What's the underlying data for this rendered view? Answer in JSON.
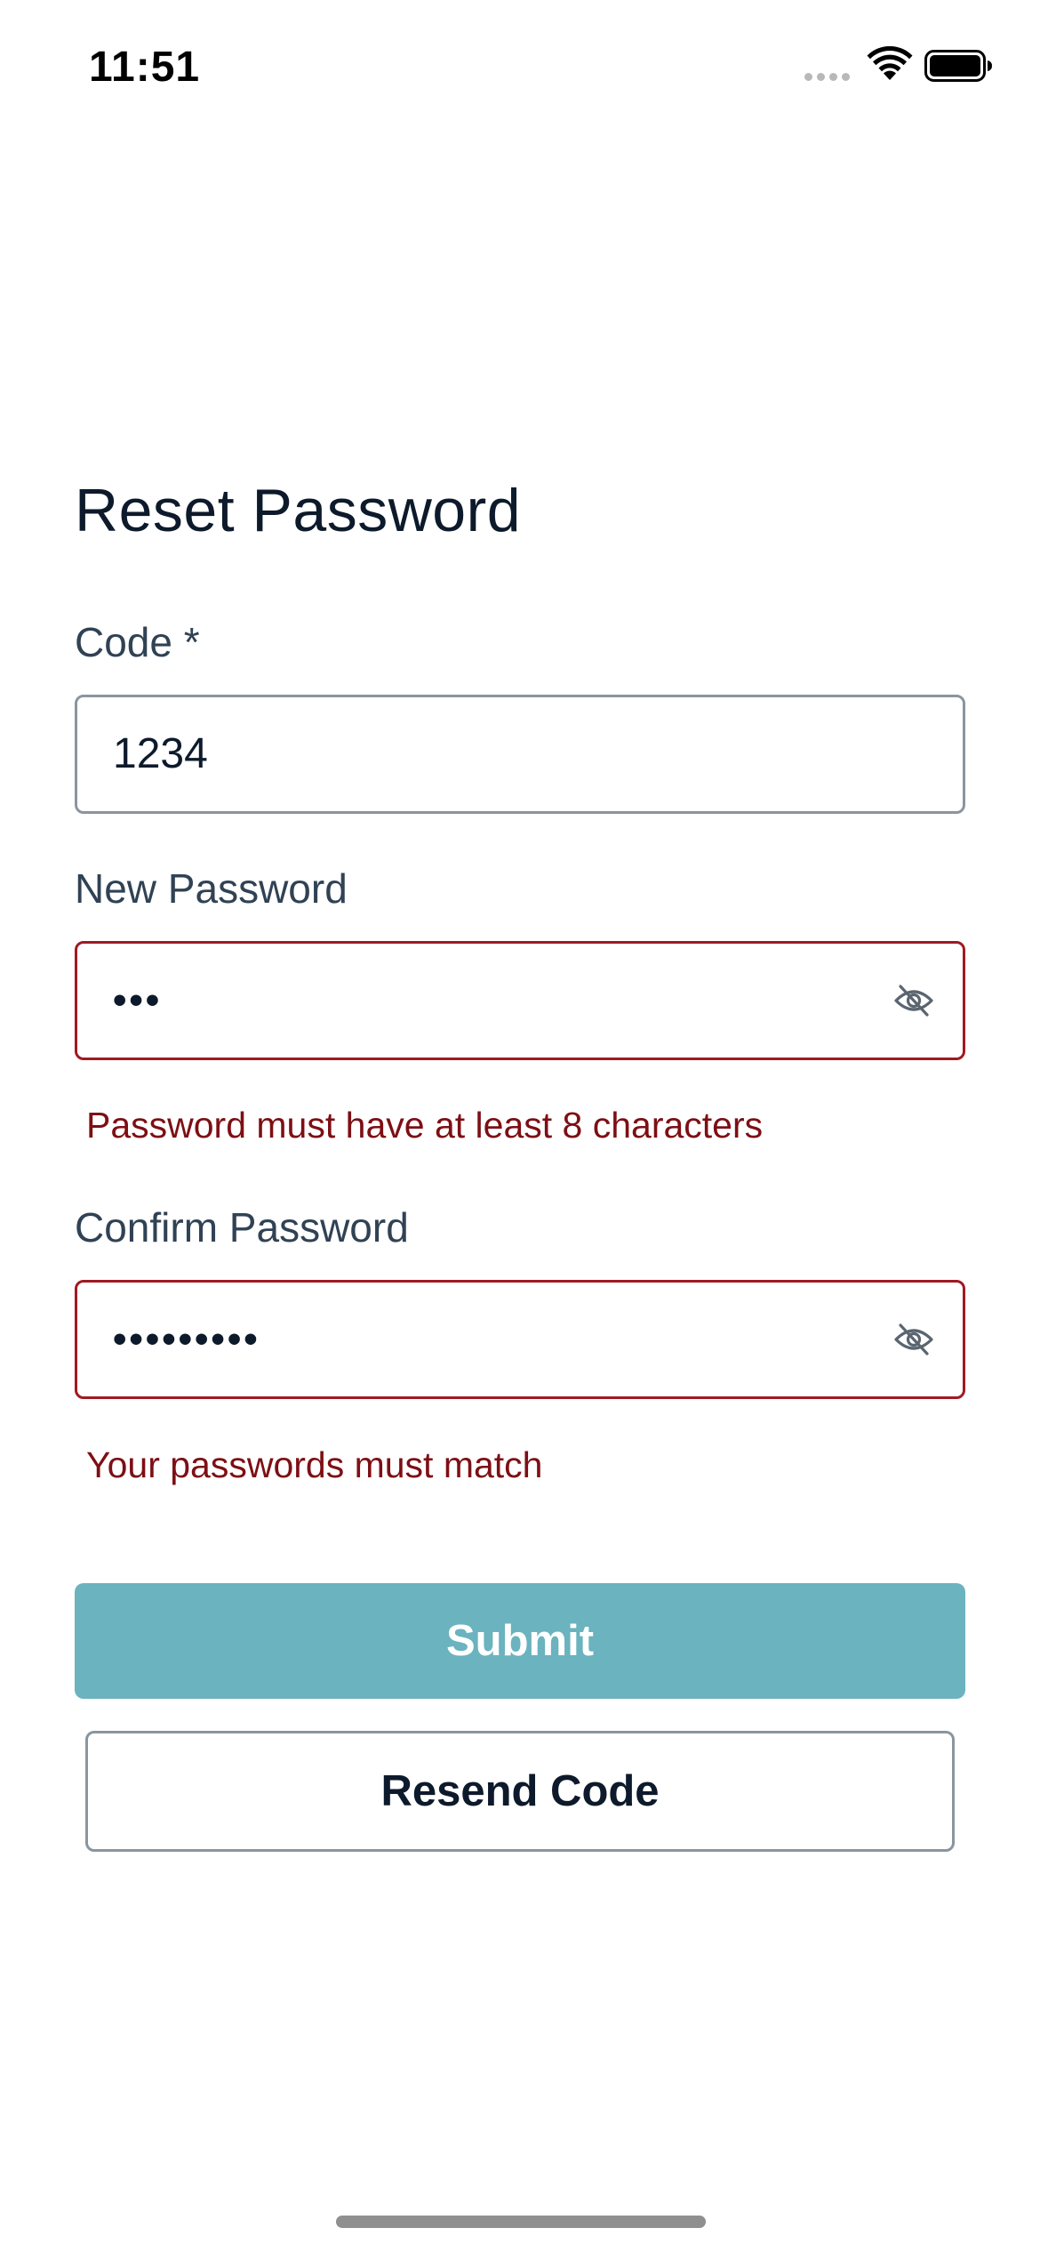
{
  "status_bar": {
    "time": "11:51"
  },
  "form": {
    "title": "Reset Password",
    "code": {
      "label": "Code *",
      "value": "1234"
    },
    "new_password": {
      "label": "New Password",
      "value": "•••",
      "error": "Password must have at least 8 characters",
      "toggle_icon": "eye-off-icon"
    },
    "confirm_password": {
      "label": "Confirm Password",
      "value": "•••••••••",
      "error": "Your passwords must match",
      "toggle_icon": "eye-off-icon"
    }
  },
  "actions": {
    "submit_label": "Submit",
    "resend_label": "Resend Code"
  },
  "colors": {
    "accent": "#6ab3bf",
    "error": "#a01a22",
    "error_text": "#7d0f14",
    "text": "#0d1a2b",
    "label": "#304254",
    "border": "#8a959f"
  }
}
